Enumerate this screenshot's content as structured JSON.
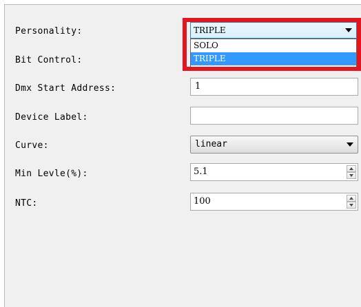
{
  "form": {
    "personality": {
      "label": "Personality:",
      "value": "TRIPLE",
      "options": [
        "SOLO",
        "TRIPLE"
      ],
      "selected_option": "TRIPLE"
    },
    "bit_control": {
      "label": "Bit Control:"
    },
    "dmx_start_address": {
      "label": "Dmx Start Address:",
      "value": "1"
    },
    "device_label": {
      "label": "Device Label:",
      "value": ""
    },
    "curve": {
      "label": "Curve:",
      "value": "linear"
    },
    "min_level": {
      "label": "Min Levle(%):",
      "value": "5.1"
    },
    "ntc": {
      "label": "NTC:",
      "value": "100"
    }
  },
  "highlight_color": "#e3161f",
  "selection_color": "#3399ff",
  "icons": [
    "chevron-down-icon",
    "spin-up-icon",
    "spin-down-icon"
  ]
}
